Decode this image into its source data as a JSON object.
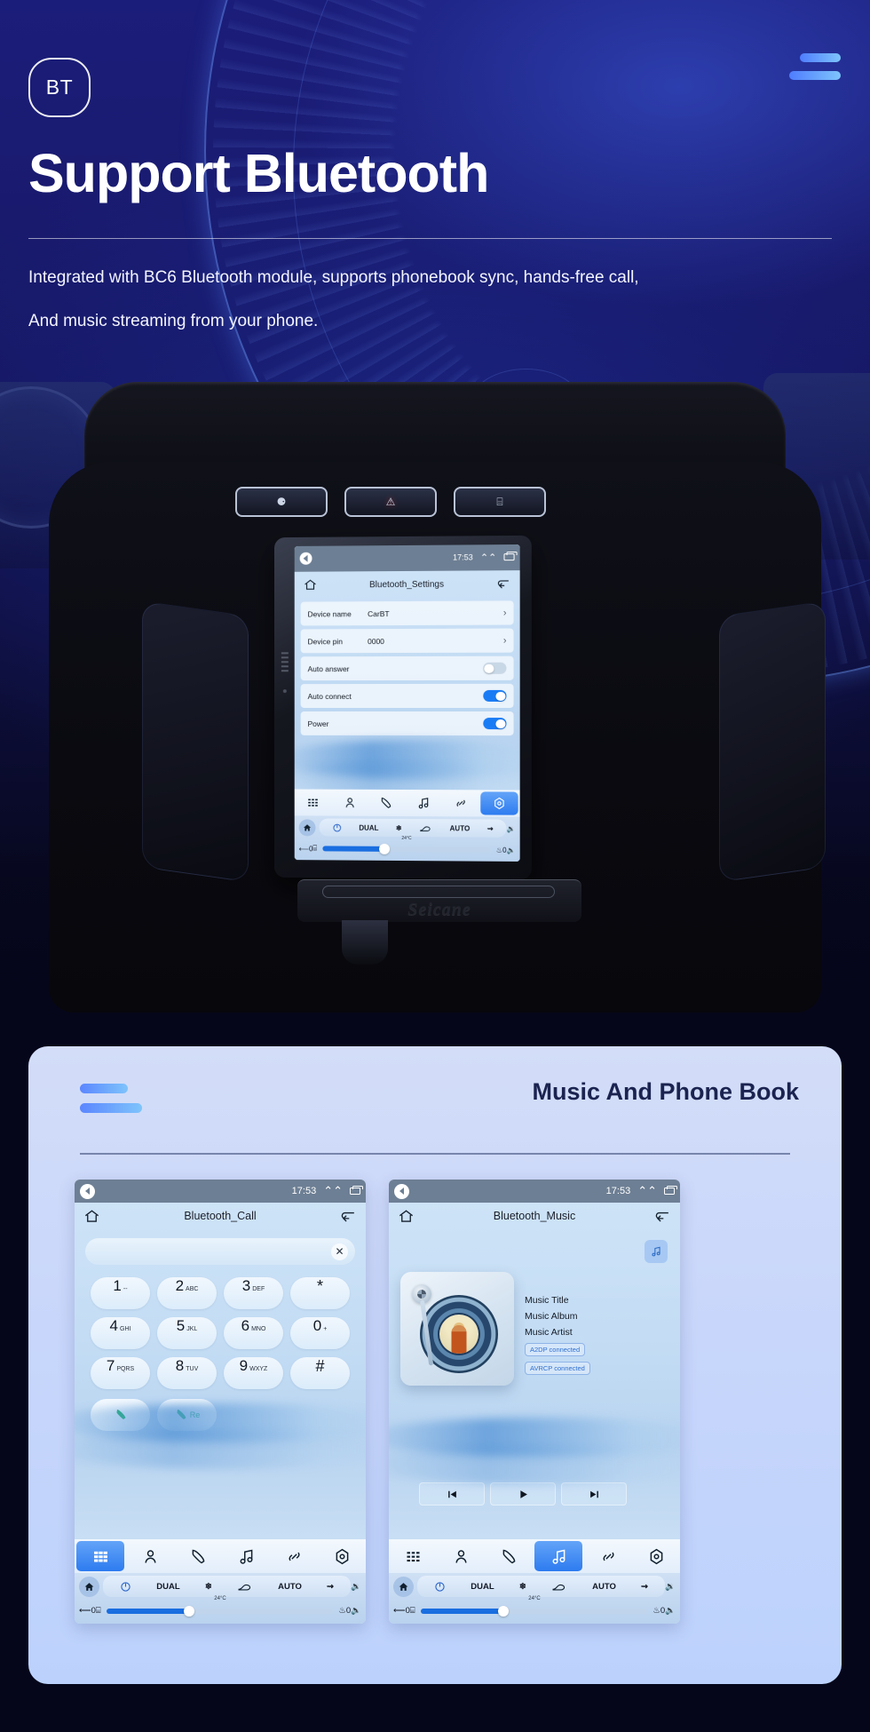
{
  "hero": {
    "badge": "BT",
    "title": "Support Bluetooth",
    "subtitle_line1": "Integrated with BC6 Bluetooth module, supports phonebook sync, hands-free call,",
    "subtitle_line2": "And music streaming from your phone.",
    "accent": "#4f7dff",
    "background": "#16176a"
  },
  "dash": {
    "brand": "Seicane",
    "buttons": [
      {
        "name": "seat-adjust-button",
        "glyph": "⚈"
      },
      {
        "name": "hazard-button",
        "glyph": "⚠"
      },
      {
        "name": "rear-defrost-button",
        "glyph": "⌸"
      }
    ]
  },
  "head_unit": {
    "statusbar": {
      "time": "17:53",
      "chevron": "«",
      "recents": "recents-icon"
    },
    "appbar": {
      "home": "home-icon",
      "title": "Bluetooth_Settings",
      "back": "back-icon"
    },
    "settings": [
      {
        "label": "Device name",
        "value": "CarBT",
        "control": "chevron"
      },
      {
        "label": "Device pin",
        "value": "0000",
        "control": "chevron"
      },
      {
        "label": "Auto answer",
        "value": "",
        "control": "toggle",
        "state": "off"
      },
      {
        "label": "Auto connect",
        "value": "",
        "control": "toggle",
        "state": "on"
      },
      {
        "label": "Power",
        "value": "",
        "control": "toggle",
        "state": "on"
      }
    ],
    "tabs": [
      {
        "name": "apps",
        "active": false
      },
      {
        "name": "contacts",
        "active": false
      },
      {
        "name": "phone",
        "active": false
      },
      {
        "name": "music",
        "active": false
      },
      {
        "name": "link",
        "active": false
      },
      {
        "name": "settings",
        "active": true
      }
    ],
    "climate": {
      "dual": "DUAL",
      "auto": "AUTO",
      "temperature": "24°C",
      "left_value": "0",
      "right_value": "0",
      "volume_up": "volume-up-icon",
      "volume_down": "volume-down-icon"
    }
  },
  "card": {
    "title": "Music And Phone Book",
    "accent": "#5b86ff"
  },
  "call_screen": {
    "statusbar": {
      "time": "17:53"
    },
    "appbar": {
      "title": "Bluetooth_Call"
    },
    "search_value": "",
    "search_placeholder": "",
    "clear_label": "×",
    "keys": [
      {
        "digit": "1",
        "sub": "--"
      },
      {
        "digit": "2",
        "sub": "ABC"
      },
      {
        "digit": "3",
        "sub": "DEF"
      },
      {
        "digit": "*",
        "sub": ""
      },
      {
        "digit": "4",
        "sub": "GHI"
      },
      {
        "digit": "5",
        "sub": "JKL"
      },
      {
        "digit": "6",
        "sub": "MNO"
      },
      {
        "digit": "0",
        "sub": "+"
      },
      {
        "digit": "7",
        "sub": "PQRS"
      },
      {
        "digit": "8",
        "sub": "TUV"
      },
      {
        "digit": "9",
        "sub": "WXYZ"
      },
      {
        "digit": "#",
        "sub": ""
      }
    ],
    "call_label": "",
    "redial_label": "Re",
    "active_tab": "apps",
    "climate": {
      "dual": "DUAL",
      "auto": "AUTO",
      "temperature": "24°C",
      "left_value": "0",
      "right_value": "0"
    }
  },
  "music_screen": {
    "statusbar": {
      "time": "17:53"
    },
    "appbar": {
      "title": "Bluetooth_Music"
    },
    "track_title": "Music Title",
    "track_album": "Music Album",
    "track_artist": "Music Artist",
    "badges": [
      "A2DP  connected",
      "AVRCP connected"
    ],
    "transport": [
      {
        "name": "previous-track-button",
        "glyph": "⏮"
      },
      {
        "name": "play-button",
        "glyph": "▶"
      },
      {
        "name": "next-track-button",
        "glyph": "⏭"
      }
    ],
    "active_tab": "music",
    "climate": {
      "dual": "DUAL",
      "auto": "AUTO",
      "temperature": "24°C",
      "left_value": "0",
      "right_value": "0"
    }
  }
}
